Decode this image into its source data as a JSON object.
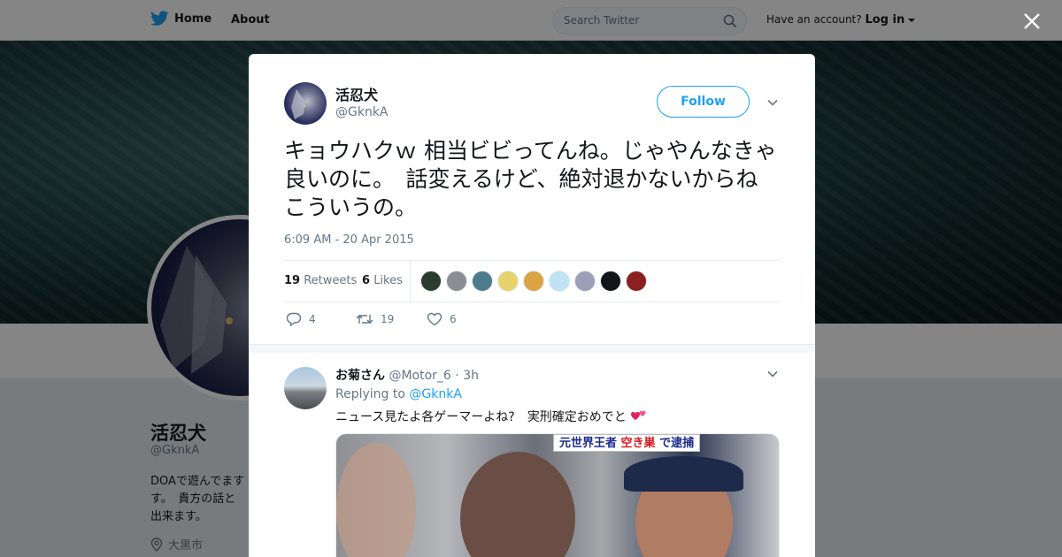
{
  "nav": {
    "home_label": "Home",
    "about_label": "About",
    "search_placeholder": "Search Twitter",
    "account_prompt": "Have an account?",
    "login_label": "Log in"
  },
  "profile": {
    "name": "活忍犬",
    "handle": "@GknkA",
    "bio": "DOAで遊んでます\nす。　貴方の話と\n出来ます。",
    "location": "大黒市"
  },
  "tweet": {
    "author_name": "活忍犬",
    "author_handle": "@GknkA",
    "follow_label": "Follow",
    "text": "キョウハクｗ 相当ビビってんね。じゃやんなきゃ良いのに。　話変えるけど、絶対退かないからねこういうの。",
    "timestamp": "6:09 AM - 20 Apr 2015",
    "retweets_count": "19",
    "retweets_label": "Retweets",
    "likes_count": "6",
    "likes_label": "Likes",
    "likers": [
      {
        "color": "#2b3b2e"
      },
      {
        "color": "#8a8d92"
      },
      {
        "color": "#4d7a8c"
      },
      {
        "color": "#e8d36a"
      },
      {
        "color": "#d9a441"
      },
      {
        "color": "#bfe3f5"
      },
      {
        "color": "#9aa0b8"
      },
      {
        "color": "#111418"
      },
      {
        "color": "#8c1f1f"
      }
    ],
    "actions": {
      "reply_count": "4",
      "retweet_count": "19",
      "like_count": "6"
    }
  },
  "reply": {
    "name": "お菊さん",
    "handle": "@Motor_6",
    "time": "3h",
    "replying_to_label": "Replying to",
    "replying_to_handle": "@GknkA",
    "text": "ニュース見たよ各ゲーマーよね?　実刑確定おめでと",
    "photo_caption_a": "元世界王者",
    "photo_caption_b": "空き巣",
    "photo_caption_c": "で逮捕"
  },
  "colors": {
    "brand": "#1da1f2",
    "heart": "#e0245e"
  }
}
